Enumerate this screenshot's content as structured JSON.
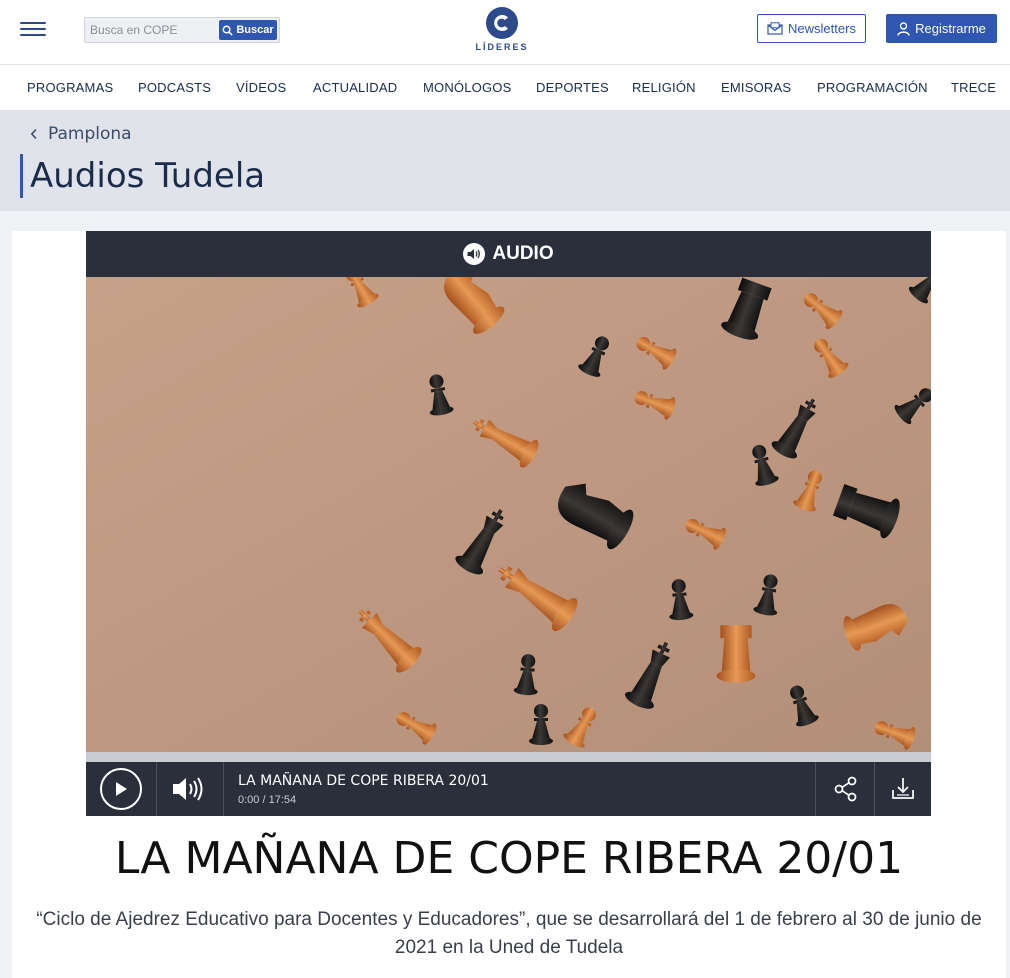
{
  "header": {
    "search_placeholder": "Busca en COPE",
    "search_button": "Buscar",
    "logo_text": "LÍDERES",
    "newsletters_label": "Newsletters",
    "register_label": "Registrarme"
  },
  "nav": {
    "items": [
      "PROGRAMAS",
      "PODCASTS",
      "VÍDEOS",
      "ACTUALIDAD",
      "MONÓLOGOS",
      "DEPORTES",
      "RELIGIÓN",
      "EMISORAS",
      "PROGRAMACIÓN",
      "TRECE"
    ]
  },
  "section": {
    "breadcrumb": "Pamplona",
    "title": "Audios Tudela"
  },
  "player": {
    "badge": "AUDIO",
    "track_title": "LA MAÑANA DE COPE RIBERA 20/01",
    "current_time": "0:00",
    "separator": " / ",
    "duration": "17:54",
    "progress": 0
  },
  "article": {
    "headline": "LA MAÑANA DE COPE RIBERA 20/01",
    "subtitle": "“Ciclo de Ajedrez Educativo para Docentes y Educadores”, que se desarrollará del 1 de febrero al 30 de junio de 2021 en la Uned de Tudela"
  },
  "colors": {
    "brand": "#2f56b0",
    "player_bg": "#2a2f3b",
    "band_bg": "#e0e4ea"
  },
  "icons": [
    "menu-icon",
    "search-icon",
    "newsletter-icon",
    "user-icon",
    "speaker-icon",
    "play-icon",
    "volume-icon",
    "share-icon",
    "download-icon",
    "chevron-left-icon"
  ]
}
